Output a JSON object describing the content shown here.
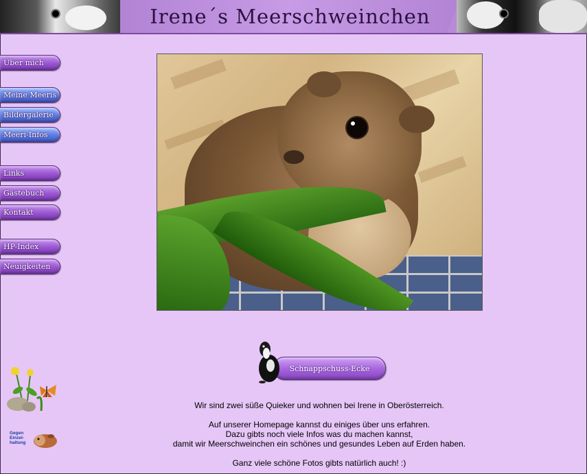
{
  "header": {
    "title": "Irene´s Meerschweinchen"
  },
  "nav": {
    "items": [
      {
        "label": "Über mich",
        "color": "purple"
      },
      {
        "label": "Meine Meeris",
        "color": "blue"
      },
      {
        "label": "Bildergalerie",
        "color": "blue"
      },
      {
        "label": "Meeri-Infos",
        "color": "blue"
      },
      {
        "label": "Links",
        "color": "purple"
      },
      {
        "label": "Gästebuch",
        "color": "purple"
      },
      {
        "label": "Kontakt",
        "color": "purple"
      },
      {
        "label": "HP-Index",
        "color": "purple"
      },
      {
        "label": "Neuigkeiten",
        "color": "purple"
      }
    ]
  },
  "main": {
    "snapshot_button": "Schnappschuss-Ecke",
    "intro_line1": "Wir sind zwei süße Quieker und wohnen bei Irene in Oberösterreich.",
    "intro_line2": "Auf unserer Homepage kannst du einiges über uns erfahren.",
    "intro_line3": "Dazu gibts noch viele Infos was du machen kannst,",
    "intro_line4": "damit wir Meerschweinchen ein schönes und gesundes Leben auf Erden haben.",
    "intro_line5": "Ganz viele schöne Fotos gibts natürlich auch! :)"
  },
  "badge": {
    "text": "Gegen Einzel- haltung"
  },
  "colors": {
    "background": "#e6c6f7",
    "nav_purple": "#9a55d0",
    "nav_blue": "#5a7ae0",
    "header": "#b98ad8"
  }
}
